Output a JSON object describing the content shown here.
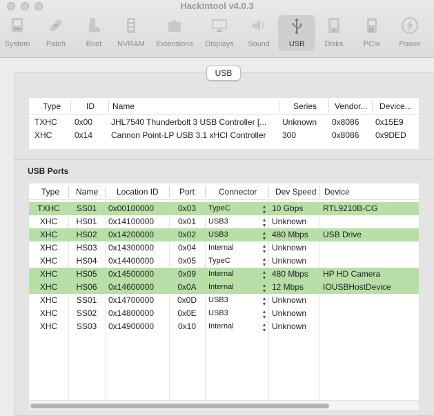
{
  "app": {
    "title": "Hackintool v4.0.3"
  },
  "toolbar": {
    "items": [
      {
        "label": "System",
        "icon": "system-icon",
        "selected": false
      },
      {
        "label": "Patch",
        "icon": "patch-icon",
        "selected": false
      },
      {
        "label": "Boot",
        "icon": "boot-icon",
        "selected": false
      },
      {
        "label": "NVRAM",
        "icon": "nvram-icon",
        "selected": false
      },
      {
        "label": "Extensions",
        "icon": "extensions-icon",
        "selected": false
      },
      {
        "label": "Displays",
        "icon": "displays-icon",
        "selected": false
      },
      {
        "label": "Sound",
        "icon": "sound-icon",
        "selected": false
      },
      {
        "label": "USB",
        "icon": "usb-icon",
        "selected": true
      },
      {
        "label": "Disks",
        "icon": "disks-icon",
        "selected": false
      },
      {
        "label": "PCIe",
        "icon": "pcie-icon",
        "selected": false
      },
      {
        "label": "Power",
        "icon": "power-icon",
        "selected": false
      }
    ]
  },
  "segment": {
    "label": "USB"
  },
  "controllers": {
    "columns": [
      "Type",
      "ID",
      "Name",
      "Series",
      "Vendor...",
      "Device..."
    ],
    "rows": [
      {
        "type": "TXHC",
        "id": "0x00",
        "name": "JHL7540 Thunderbolt 3 USB Controller [...",
        "series": "Unknown",
        "vendor": "0x8086",
        "device": "0x15E9"
      },
      {
        "type": "XHC",
        "id": "0x14",
        "name": "Cannon Point-LP USB 3.1 xHCI Controller",
        "series": "300",
        "vendor": "0x8086",
        "device": "0x9DED"
      }
    ]
  },
  "ports": {
    "title": "USB Ports",
    "columns": [
      "Type",
      "Name",
      "Location ID",
      "Port",
      "Connector",
      "Dev Speed",
      "Device"
    ],
    "rows": [
      {
        "type": "TXHC",
        "name": "SS01",
        "location": "0x00100000",
        "port": "0x03",
        "connector": "TypeC",
        "speed": "10 Gbps",
        "device": "RTL9210B-CG",
        "highlight": true
      },
      {
        "type": "XHC",
        "name": "HS01",
        "location": "0x14100000",
        "port": "0x01",
        "connector": "USB3",
        "speed": "Unknown",
        "device": "",
        "highlight": false
      },
      {
        "type": "XHC",
        "name": "HS02",
        "location": "0x14200000",
        "port": "0x02",
        "connector": "USB3",
        "speed": "480 Mbps",
        "device": "USB Drive",
        "highlight": true
      },
      {
        "type": "XHC",
        "name": "HS03",
        "location": "0x14300000",
        "port": "0x04",
        "connector": "Internal",
        "speed": "Unknown",
        "device": "",
        "highlight": false
      },
      {
        "type": "XHC",
        "name": "HS04",
        "location": "0x14400000",
        "port": "0x05",
        "connector": "TypeC",
        "speed": "Unknown",
        "device": "",
        "highlight": false
      },
      {
        "type": "XHC",
        "name": "HS05",
        "location": "0x14500000",
        "port": "0x09",
        "connector": "Internal",
        "speed": "480 Mbps",
        "device": "HP HD Camera",
        "highlight": true
      },
      {
        "type": "XHC",
        "name": "HS06",
        "location": "0x14600000",
        "port": "0x0A",
        "connector": "Internal",
        "speed": "12 Mbps",
        "device": "IOUSBHostDevice",
        "highlight": true
      },
      {
        "type": "XHC",
        "name": "SS01",
        "location": "0x14700000",
        "port": "0x0D",
        "connector": "USB3",
        "speed": "Unknown",
        "device": "",
        "highlight": false
      },
      {
        "type": "XHC",
        "name": "SS02",
        "location": "0x14800000",
        "port": "0x0E",
        "connector": "USB3",
        "speed": "Unknown",
        "device": "",
        "highlight": false
      },
      {
        "type": "XHC",
        "name": "SS03",
        "location": "0x14900000",
        "port": "0x10",
        "connector": "Internal",
        "speed": "Unknown",
        "device": "",
        "highlight": false
      }
    ]
  },
  "colors": {
    "highlight_row": "#b8dfa7",
    "selected_tab": "#cfcfcf"
  }
}
